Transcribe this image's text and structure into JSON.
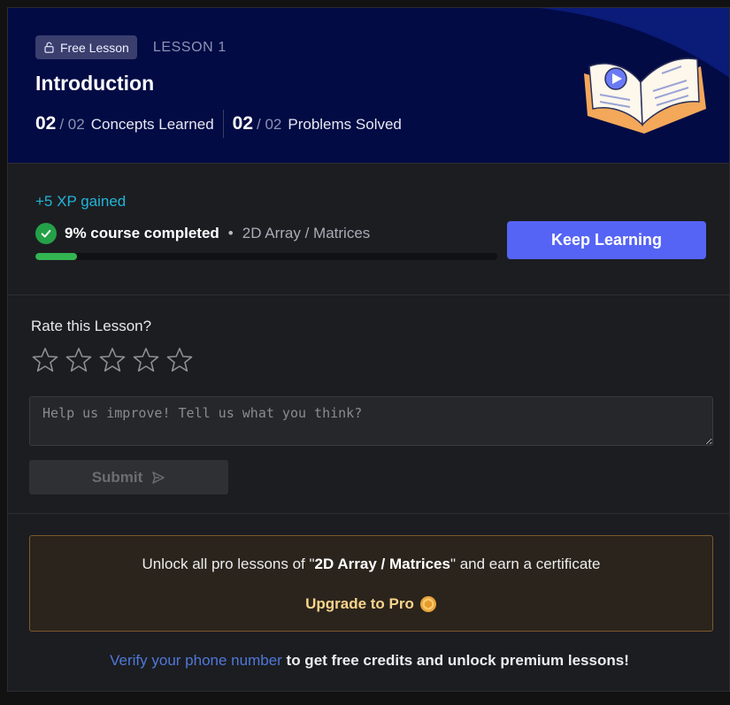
{
  "hero": {
    "badge_label": "Free Lesson",
    "lesson_number": "LESSON 1",
    "title": "Introduction",
    "concepts_done": "02",
    "concepts_total": "/ 02",
    "concepts_label": "Concepts Learned",
    "problems_done": "02",
    "problems_total": "/ 02",
    "problems_label": "Problems Solved",
    "icons": {
      "badge": "unlock-icon",
      "illustration": "open-book-play-icon"
    },
    "colors": {
      "background": "#020b44",
      "wave": "#0a1b78"
    }
  },
  "progress": {
    "xp_text": "+5 XP gained",
    "completed_text": "9% course completed",
    "separator": "•",
    "topic": "2D Array / Matrices",
    "percent": 9,
    "keep_learning_label": "Keep Learning",
    "colors": {
      "accent": "#5664f5",
      "bar": "#33b552",
      "check": "#24a148",
      "xp": "#22b4d6"
    }
  },
  "rating": {
    "title": "Rate this Lesson?",
    "stars_total": 5,
    "selected": 0,
    "feedback_placeholder": "Help us improve! Tell us what you think?",
    "feedback_value": "",
    "submit_label": "Submit"
  },
  "pro": {
    "text_prefix": "Unlock all pro lessons of \"",
    "course_name": "2D Array / Matrices",
    "text_suffix": "\" and earn a certificate",
    "upgrade_label": "Upgrade to Pro",
    "colors": {
      "border": "#7a5a2c",
      "upgrade": "#f7d48c"
    }
  },
  "verify": {
    "link_text": "Verify your phone number",
    "rest_text": " to get free credits and unlock premium lessons!"
  }
}
